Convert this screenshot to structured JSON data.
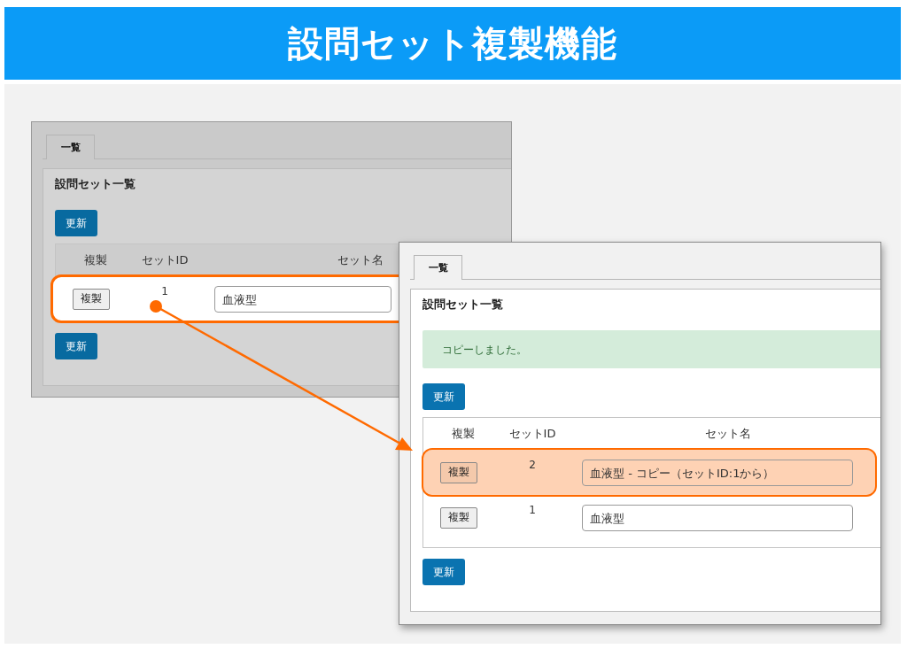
{
  "banner": {
    "title": "設問セット複製機能"
  },
  "screens": [
    {
      "dimmed": true,
      "tab": "一覧",
      "heading": "設問セット一覧",
      "update_top": "更新",
      "columns": [
        "複製",
        "セットID",
        "セット名"
      ],
      "rows": [
        {
          "button": "複製",
          "id": "1",
          "name": "血液型",
          "highlighted": true
        }
      ],
      "update_bottom": "更新"
    },
    {
      "dimmed": false,
      "tab": "一覧",
      "heading": "設問セット一覧",
      "notice": "コピーしました。",
      "update_top": "更新",
      "columns": [
        "複製",
        "セットID",
        "セット名"
      ],
      "rows": [
        {
          "button": "複製",
          "id": "2",
          "name": "血液型 - コピー（セットID:1から）",
          "highlighted": true
        },
        {
          "button": "複製",
          "id": "1",
          "name": "血液型",
          "highlighted": false
        }
      ],
      "update_bottom": "更新"
    }
  ]
}
